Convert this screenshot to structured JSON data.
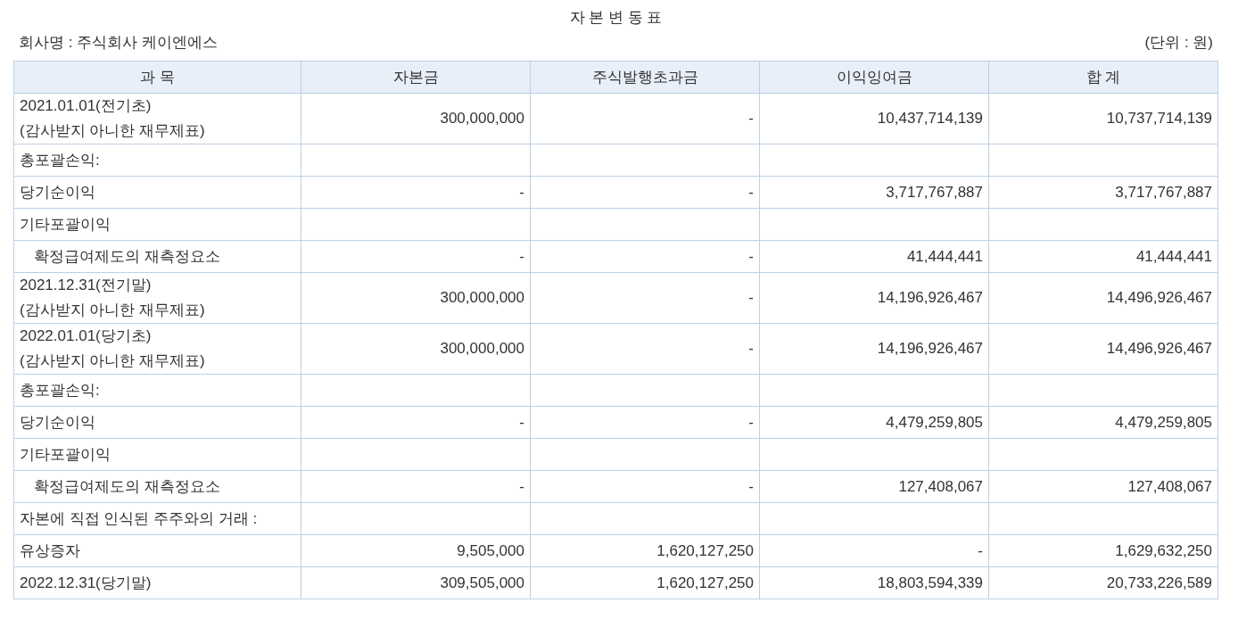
{
  "title": "자 본 변 동 표",
  "company": "회사명 : 주식회사 케이엔에스",
  "unit": "(단위 : 원)",
  "table": {
    "columns": [
      "과  목",
      "자본금",
      "주식발행초과금",
      "이익잉여금",
      "합  계"
    ],
    "rows": [
      {
        "cells": [
          "2021.01.01(전기초)\n(감사받지 아니한 재무제표)",
          "300,000,000",
          "-",
          "10,437,714,139",
          "10,737,714,139"
        ]
      },
      {
        "cells": [
          "총포괄손익:",
          "",
          "",
          "",
          ""
        ]
      },
      {
        "cells": [
          "당기순이익",
          "-",
          "-",
          "3,717,767,887",
          "3,717,767,887"
        ]
      },
      {
        "cells": [
          "기타포괄이익",
          "",
          "",
          "",
          ""
        ],
        "children": [
          {
            "cells": [
              "확정급여제도의 재측정요소",
              "-",
              "-",
              "41,444,441",
              "41,444,441"
            ]
          }
        ]
      },
      {
        "cells": [
          "2021.12.31(전기말)\n(감사받지 아니한 재무제표)",
          "300,000,000",
          "-",
          "14,196,926,467",
          "14,496,926,467"
        ]
      },
      {
        "cells": [
          "2022.01.01(당기초)\n(감사받지 아니한 재무제표)",
          "300,000,000",
          "-",
          "14,196,926,467",
          "14,496,926,467"
        ]
      },
      {
        "cells": [
          "총포괄손익:",
          "",
          "",
          "",
          ""
        ]
      },
      {
        "cells": [
          "당기순이익",
          "-",
          "-",
          "4,479,259,805",
          "4,479,259,805"
        ]
      },
      {
        "cells": [
          "기타포괄이익",
          "",
          "",
          "",
          ""
        ],
        "children": [
          {
            "cells": [
              "확정급여제도의 재측정요소",
              "-",
              "-",
              "127,408,067",
              "127,408,067"
            ]
          }
        ]
      },
      {
        "cells": [
          "자본에 직접 인식된 주주와의 거래 :",
          "",
          "",
          "",
          ""
        ]
      },
      {
        "cells": [
          "유상증자",
          "9,505,000",
          "1,620,127,250",
          "-",
          "1,629,632,250"
        ]
      },
      {
        "cells": [
          "2022.12.31(당기말)",
          "309,505,000",
          "1,620,127,250",
          "18,803,594,339",
          "20,733,226,589"
        ]
      }
    ]
  }
}
